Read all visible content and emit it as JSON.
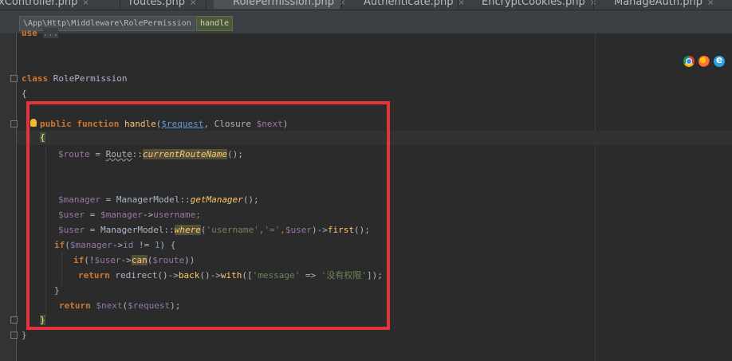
{
  "tabs": [
    {
      "label": "IndexController.php",
      "active": false
    },
    {
      "label": "routes.php",
      "active": false
    },
    {
      "label": "RolePermission.php",
      "active": true
    },
    {
      "label": "Authenticate.php",
      "active": false
    },
    {
      "label": "EncryptCookies.php",
      "active": false
    },
    {
      "label": "ManageAuth.php",
      "active": false
    }
  ],
  "tab_close_glyph": "×",
  "breadcrumbs": {
    "namespace": "\\App\\Http\\Middleware\\RolePermission",
    "method": "handle"
  },
  "code": {
    "use_kw": "use",
    "use_fold": "...",
    "class_kw": "class",
    "class_name": "RolePermission",
    "open_brace": "{",
    "close_brace": "}",
    "l_public": "public",
    "l_function": "function",
    "l_handle": "handle",
    "l_paren_open": "(",
    "l_request_param": "$request",
    "l_comma_closure": ", Closure ",
    "l_next_param": "$next",
    "l_paren_close": ")",
    "route_var": "$route",
    "route_eq": " = ",
    "route_class": "Route",
    "route_sep": "::",
    "route_method": "currentRouteName",
    "route_call_end": "();",
    "manager_var": "$manager",
    "manager_rest": " = ManagerModel::",
    "manager_method": "getManager",
    "manager_end": "();",
    "user1_var": "$user",
    "user1_eq": " = ",
    "user1_mgr": "$manager",
    "user1_arrow": "->",
    "user1_prop": "username",
    "user1_semicolon": ";",
    "user2_var": "$user",
    "user2_rest": " = ManagerModel::",
    "user2_where": "where",
    "user2_open": "(",
    "user2_str1": "'username'",
    "user2_comma1": ",",
    "user2_str2": "'='",
    "user2_comma2": ",",
    "user2_user": "$user",
    "user2_close": ")->",
    "user2_first": "first",
    "user2_end": "();",
    "if1_kw": "if",
    "if1_open": "(",
    "if1_mgr": "$manager",
    "if1_arrow": "->",
    "if1_prop": "id",
    "if1_neq": " != ",
    "if1_num": "1",
    "if1_end": ") {",
    "if2_kw": "if",
    "if2_open": "(!",
    "if2_user": "$user",
    "if2_arrow": "->",
    "if2_can": "can",
    "if2_paren": "(",
    "if2_route": "$route",
    "if2_end": "))",
    "ret1_kw": "return",
    "ret1_redirect": " redirect",
    "ret1_p1": "()->",
    "ret1_back": "back",
    "ret1_p2": "()->",
    "ret1_with": "with",
    "ret1_open": "([",
    "ret1_key": "'message'",
    "ret1_arrow": " => ",
    "ret1_val": "'没有权限'",
    "ret1_end": "]);",
    "if1_close": "}",
    "ret2_kw": "return",
    "ret2_sp": " ",
    "ret2_next": "$next",
    "ret2_open": "(",
    "ret2_req": "$request",
    "ret2_end": ");",
    "method_close": "}",
    "class_close": "}"
  },
  "colors": {
    "editor_bg": "#2b2b2b",
    "keyword": "#cc7832",
    "variable": "#9876aa",
    "method": "#ffc66d",
    "string": "#6a8759",
    "number": "#6897bb",
    "highlight_box": "#e8323a"
  },
  "icons": [
    "bulb-icon",
    "chrome-icon",
    "firefox-icon",
    "ie-icon"
  ]
}
